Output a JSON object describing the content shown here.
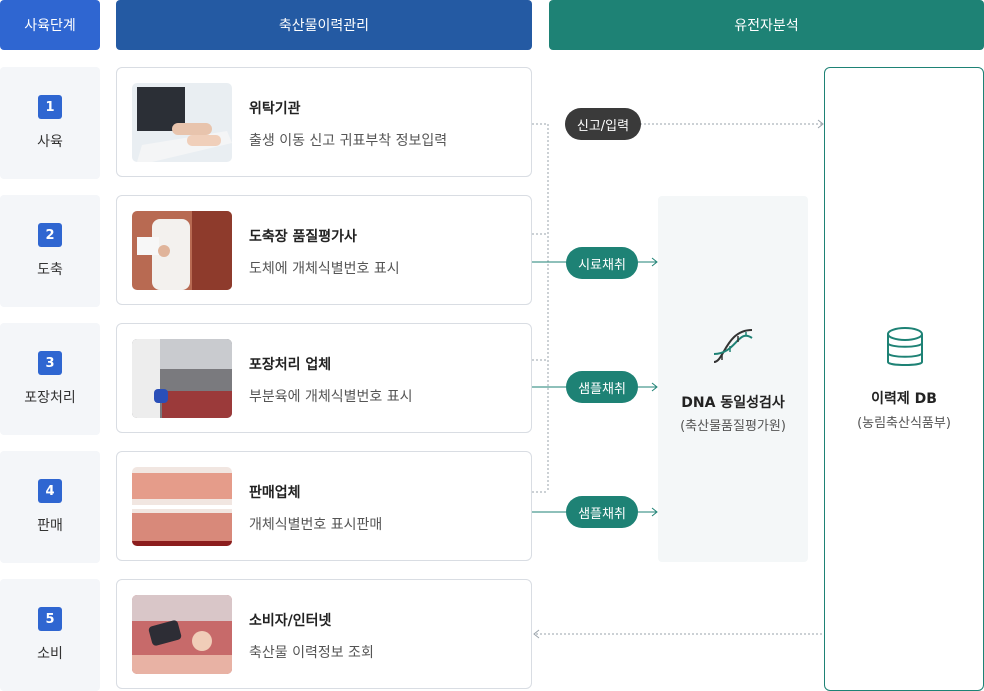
{
  "headers": {
    "stage": "사육단계",
    "traceability": "축산물이력관리",
    "genetic": "유전자분석"
  },
  "colors": {
    "blue": "#2f66d1",
    "navy": "#245aa3",
    "teal": "#1e8275",
    "dark": "#3a3a3a"
  },
  "stages": [
    {
      "num": "1",
      "name": "사육"
    },
    {
      "num": "2",
      "name": "도축"
    },
    {
      "num": "3",
      "name": "포장처리"
    },
    {
      "num": "4",
      "name": "판매"
    },
    {
      "num": "5",
      "name": "소비"
    }
  ],
  "cards": [
    {
      "title": "위탁기관",
      "desc": "출생 이동 신고 귀표부착 정보입력",
      "photo": "keyboard-typing-photo"
    },
    {
      "title": "도축장 품질평가사",
      "desc": "도체에 개체식별번호 표시",
      "photo": "carcass-inspection-photo"
    },
    {
      "title": "포장처리 업체",
      "desc": "부분육에 개체식별번호 표시",
      "photo": "meat-packing-photo"
    },
    {
      "title": "판매업체",
      "desc": "개체식별번호 표시판매",
      "photo": "meat-display-case-photo"
    },
    {
      "title": "소비자/인터넷",
      "desc": "축산물 이력정보 조회",
      "photo": "smartphone-scan-photo"
    }
  ],
  "pills": {
    "report": "신고/입력",
    "sample1": "시료채취",
    "sample2": "샘플채취",
    "sample3": "샘플채취"
  },
  "dna_box": {
    "title": "DNA 동일성검사",
    "sub": "(축산물품질평가원)",
    "icon": "dna-icon"
  },
  "db_box": {
    "title": "이력제 DB",
    "sub": "(농림축산식품부)",
    "icon": "database-icon"
  }
}
